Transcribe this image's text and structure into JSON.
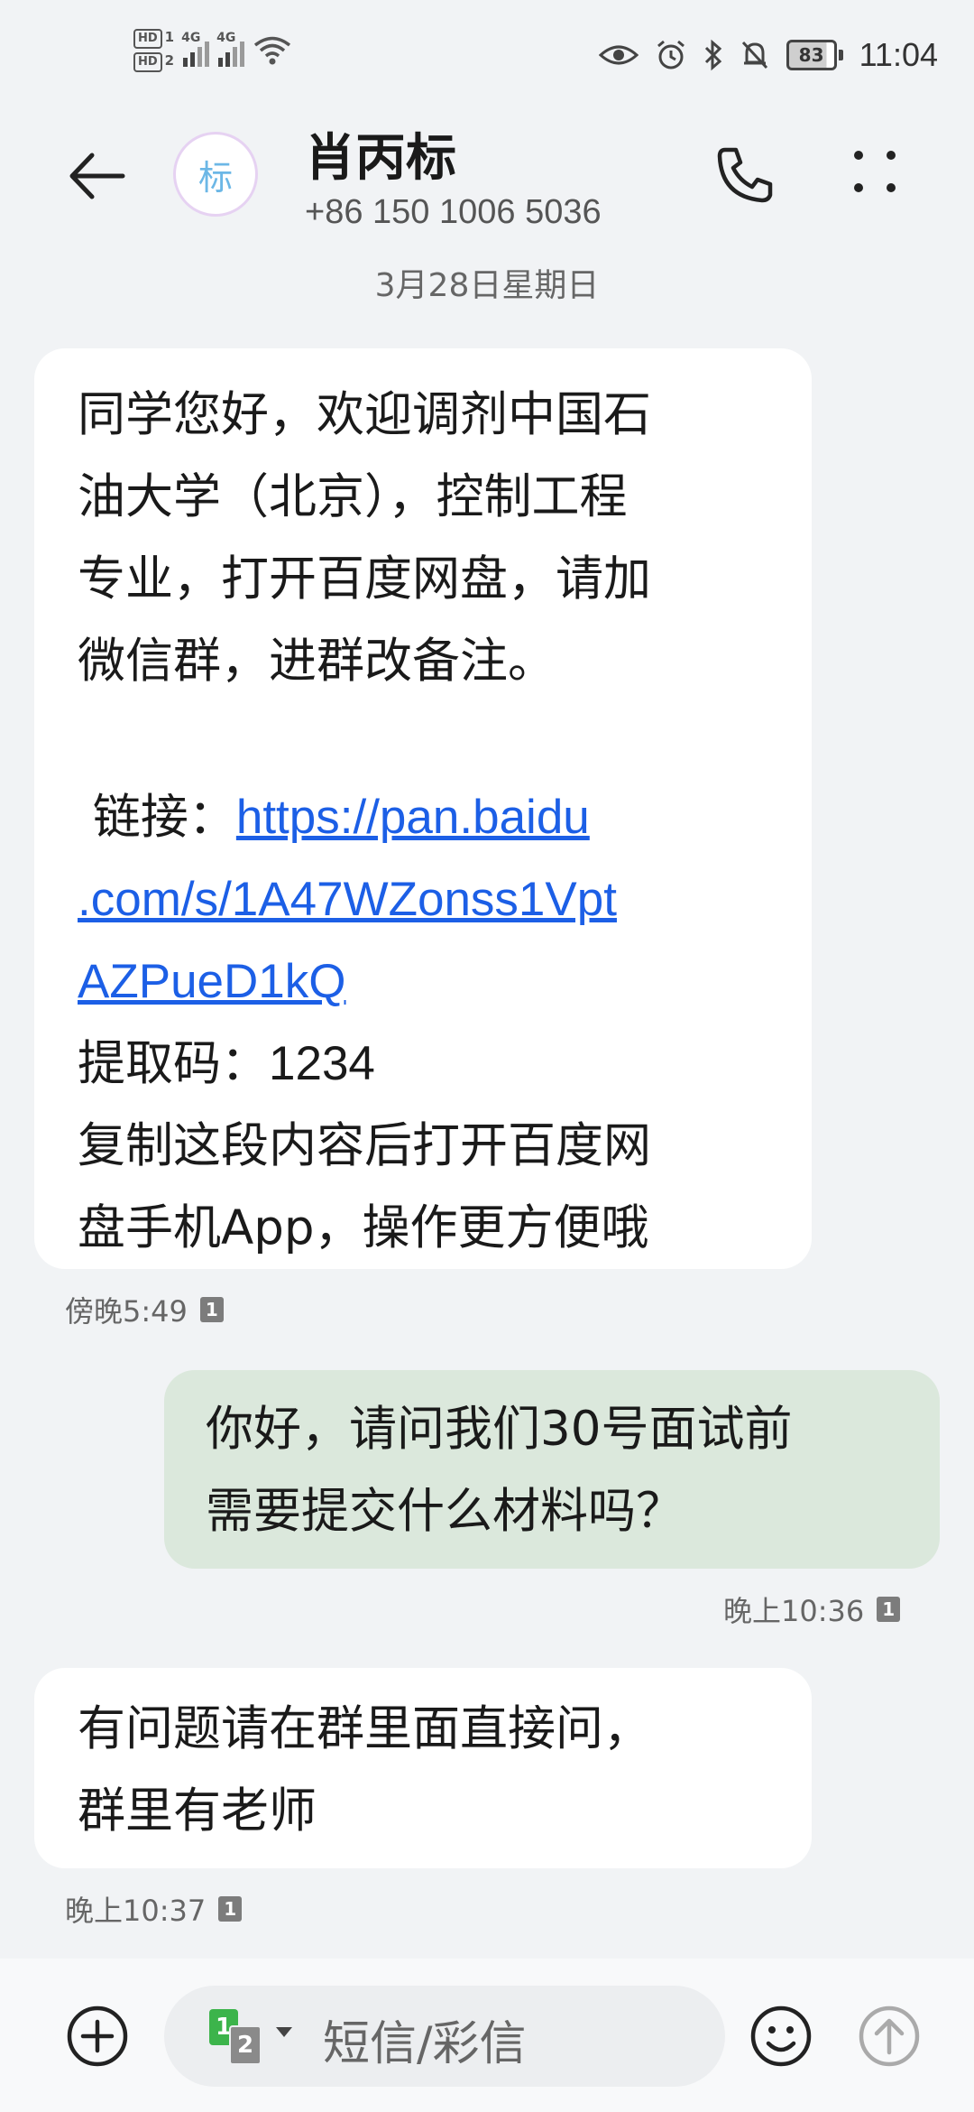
{
  "status_bar": {
    "hd1": "HD",
    "hd1_sim": "1",
    "hd2": "HD",
    "hd2_sim": "2",
    "net1": "4G",
    "net2": "4G",
    "battery": "83",
    "time": "11:04"
  },
  "header": {
    "avatar_char": "标",
    "name": "肖丙标",
    "number": "+86 150 1006 5036",
    "date": "3月28日星期日"
  },
  "messages": [
    {
      "direction": "incoming",
      "lines": [
        "同学您好，欢迎调剂中国石",
        "油大学（北京），控制工程",
        "专业，打开百度网盘，请加",
        "微信群，进群改备注。"
      ],
      "link_label": " 链接：",
      "link_lines": [
        "https://pan.baidu",
        ".com/s/1A47WZonss1Vpt",
        "AZPueD1kQ"
      ],
      "code_label": "提取码：",
      "code": "1234",
      "tail_lines": [
        "复制这段内容后打开百度网",
        "盘手机App，操作更方便哦"
      ],
      "time": "傍晚5:49",
      "sim": "1"
    },
    {
      "direction": "outgoing",
      "lines": [
        "你好，请问我们30号面试前",
        "需要提交什么材料吗？"
      ],
      "time": "晚上10:36",
      "sim": "1"
    },
    {
      "direction": "incoming",
      "lines": [
        "有问题请在群里面直接问，",
        "群里有老师"
      ],
      "time": "晚上10:37",
      "sim": "1"
    }
  ],
  "composer": {
    "sim_primary": "1",
    "sim_secondary": "2",
    "placeholder": "短信/彩信"
  }
}
